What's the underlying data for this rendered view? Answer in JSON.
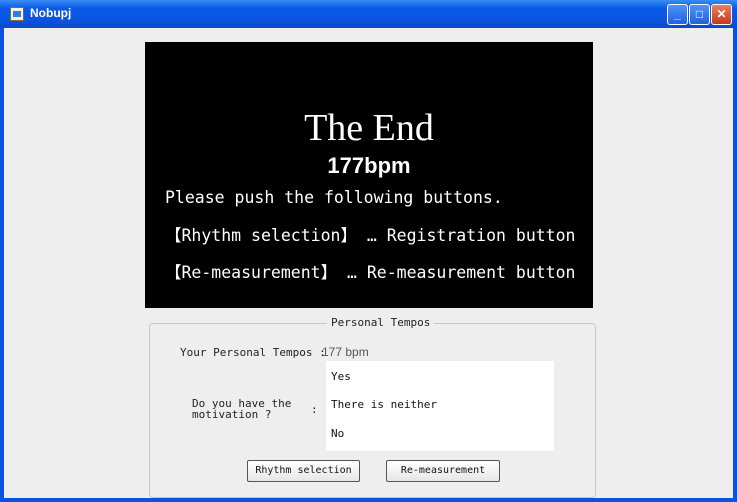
{
  "window": {
    "title": "Nobupj",
    "controls": {
      "minimize": "_",
      "maximize": "□",
      "close": "✕"
    }
  },
  "screen": {
    "title": "The End",
    "bpm": "177bpm",
    "instruction": "Please push the following buttons.",
    "line_rhythm": "【Rhythm selection】 … Registration button",
    "line_remeasure": "【Re-measurement】 … Re-measurement button"
  },
  "panel": {
    "legend": "Personal Tempos",
    "tempo_label": "Your Personal Tempos :",
    "tempo_value": "177  bpm",
    "motivation_label": "Do you have the\nmotivation ?",
    "motivation_colon": ":",
    "options": [
      "Yes",
      "There is neither",
      "No"
    ],
    "rhythm_button": "Rhythm selection",
    "remeasure_button": "Re-measurement"
  },
  "colors": {
    "titlebar": "#0a55e0",
    "screen_bg": "#000000",
    "panel_bg": "#eeeeee"
  }
}
